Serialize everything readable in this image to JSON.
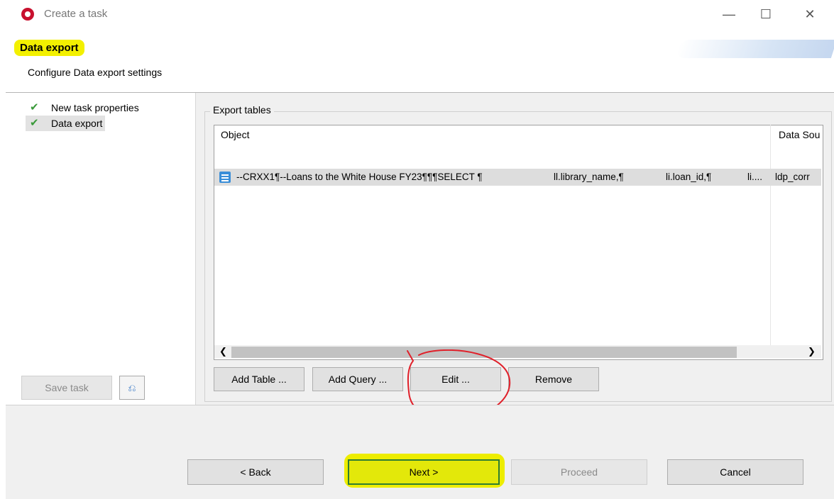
{
  "window": {
    "title": "Create a task",
    "controls": {
      "minimize": "—",
      "maximize": "☐",
      "close": "✕"
    }
  },
  "header": {
    "title": "Data export",
    "subtitle": "Configure Data export settings",
    "highlight_color": "#f3f000"
  },
  "sidebar": {
    "items": [
      {
        "label": "New task properties",
        "status_icon": "check-icon",
        "selected": false
      },
      {
        "label": "Data export",
        "status_icon": "check-icon",
        "selected": true
      }
    ],
    "save_task_label": "Save task",
    "preview_icon": "⎌"
  },
  "export_tables": {
    "group_label": "Export tables",
    "columns": [
      "Object",
      "Data Sou"
    ],
    "rows": [
      {
        "icon": "query-document-icon",
        "cells": [
          "--CRXX1¶--Loans to the White House FY23¶¶¶SELECT ¶",
          "ll.library_name,¶",
          "li.loan_id,¶",
          "li...."
        ],
        "data_source": "ldp_corr"
      }
    ],
    "buttons": {
      "add_table": "Add Table ...",
      "add_query": "Add Query ...",
      "edit": "Edit ...",
      "remove": "Remove"
    }
  },
  "footer": {
    "back": "< Back",
    "next": "Next >",
    "proceed": "Proceed",
    "cancel": "Cancel"
  },
  "colors": {
    "accent_green": "#3a9a3a",
    "annotation_red": "#e0202a",
    "highlight_yellow": "#eded00"
  }
}
